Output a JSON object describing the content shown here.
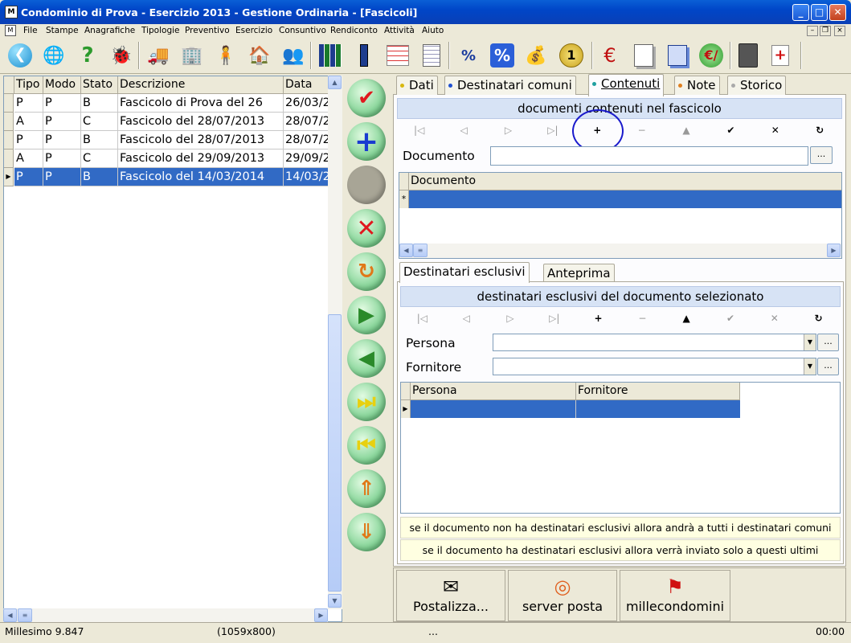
{
  "window": {
    "title": "Condominio di Prova - Esercizio 2013 - Gestione Ordinaria - [Fascicoli]"
  },
  "menu": [
    "File",
    "Stampe",
    "Anagrafiche",
    "Tipologie",
    "Preventivo",
    "Esercizio",
    "Consuntivo",
    "Rendiconto",
    "Attività",
    "Aiuto"
  ],
  "toolbar_icons": [
    "back-arrow-icon",
    "world-mail-icon",
    "help-question-icon",
    "bug-icon",
    "truck-icon",
    "building-icon",
    "person-icon",
    "house-icon",
    "people-group-icon",
    "binders-icon",
    "binder-icon",
    "spreadsheet-icon",
    "notebook-icon",
    "percent-doc-icon",
    "percent-icon",
    "money-bag-icon",
    "euro-coin-icon",
    "euro-sign-icon",
    "copy-pages-icon",
    "copy-docs-icon",
    "euro-exchange-icon",
    "calculator-icon",
    "first-aid-icon"
  ],
  "grid": {
    "columns": [
      "Tipo",
      "Modo",
      "Stato",
      "Descrizione",
      "Data"
    ],
    "rows": [
      {
        "tipo": "P",
        "modo": "P",
        "stato": "B",
        "descrizione": "Fascicolo di Prova del 26",
        "data": "26/03/2"
      },
      {
        "tipo": "A",
        "modo": "P",
        "stato": "C",
        "descrizione": "Fascicolo del 28/07/2013",
        "data": "28/07/2"
      },
      {
        "tipo": "P",
        "modo": "P",
        "stato": "B",
        "descrizione": "Fascicolo del 28/07/2013",
        "data": "28/07/2"
      },
      {
        "tipo": "A",
        "modo": "P",
        "stato": "C",
        "descrizione": "Fascicolo del 29/09/2013",
        "data": "29/09/2"
      },
      {
        "tipo": "P",
        "modo": "P",
        "stato": "B",
        "descrizione": "Fascicolo del 14/03/2014",
        "data": "14/03/2"
      }
    ],
    "selected_row": 4
  },
  "tabs": [
    "Dati",
    "Destinatari comuni",
    "Contenuti",
    "Note",
    "Storico"
  ],
  "active_tab": "Contenuti",
  "contenuti": {
    "caption": "documenti contenuti nel fascicolo",
    "documento_label": "Documento",
    "documento_value": "",
    "grid_header": "Documento",
    "ellipsis": "..."
  },
  "subtabs": [
    "Destinatari esclusivi",
    "Anteprima"
  ],
  "destinatari": {
    "caption": "destinatari esclusivi del documento selezionato",
    "persona_label": "Persona",
    "fornitore_label": "Fornitore",
    "grid_headers": [
      "Persona",
      "Fornitore"
    ],
    "ellipsis": "..."
  },
  "notes": [
    "se il documento non ha destinatari esclusivi allora andrà a tutti i destinatari comuni",
    "se il documento ha destinatari esclusivi allora verrà inviato solo a questi ultimi"
  ],
  "bottom_buttons": [
    {
      "label": "Postalizza...",
      "icon": "mail-globe-icon"
    },
    {
      "label": "server posta",
      "icon": "mail-server-icon"
    },
    {
      "label": "millecondomini",
      "icon": "acrobat-globe-icon"
    }
  ],
  "status": {
    "left": "Millesimo 9.847",
    "size": "(1059x800)",
    "middle": "...",
    "time": "00:00"
  },
  "colors": {
    "title": "#0a5fd6",
    "selection": "#316ac5",
    "caption_bg": "#d7e3f5",
    "highlight_circle": "#1a1acc"
  }
}
